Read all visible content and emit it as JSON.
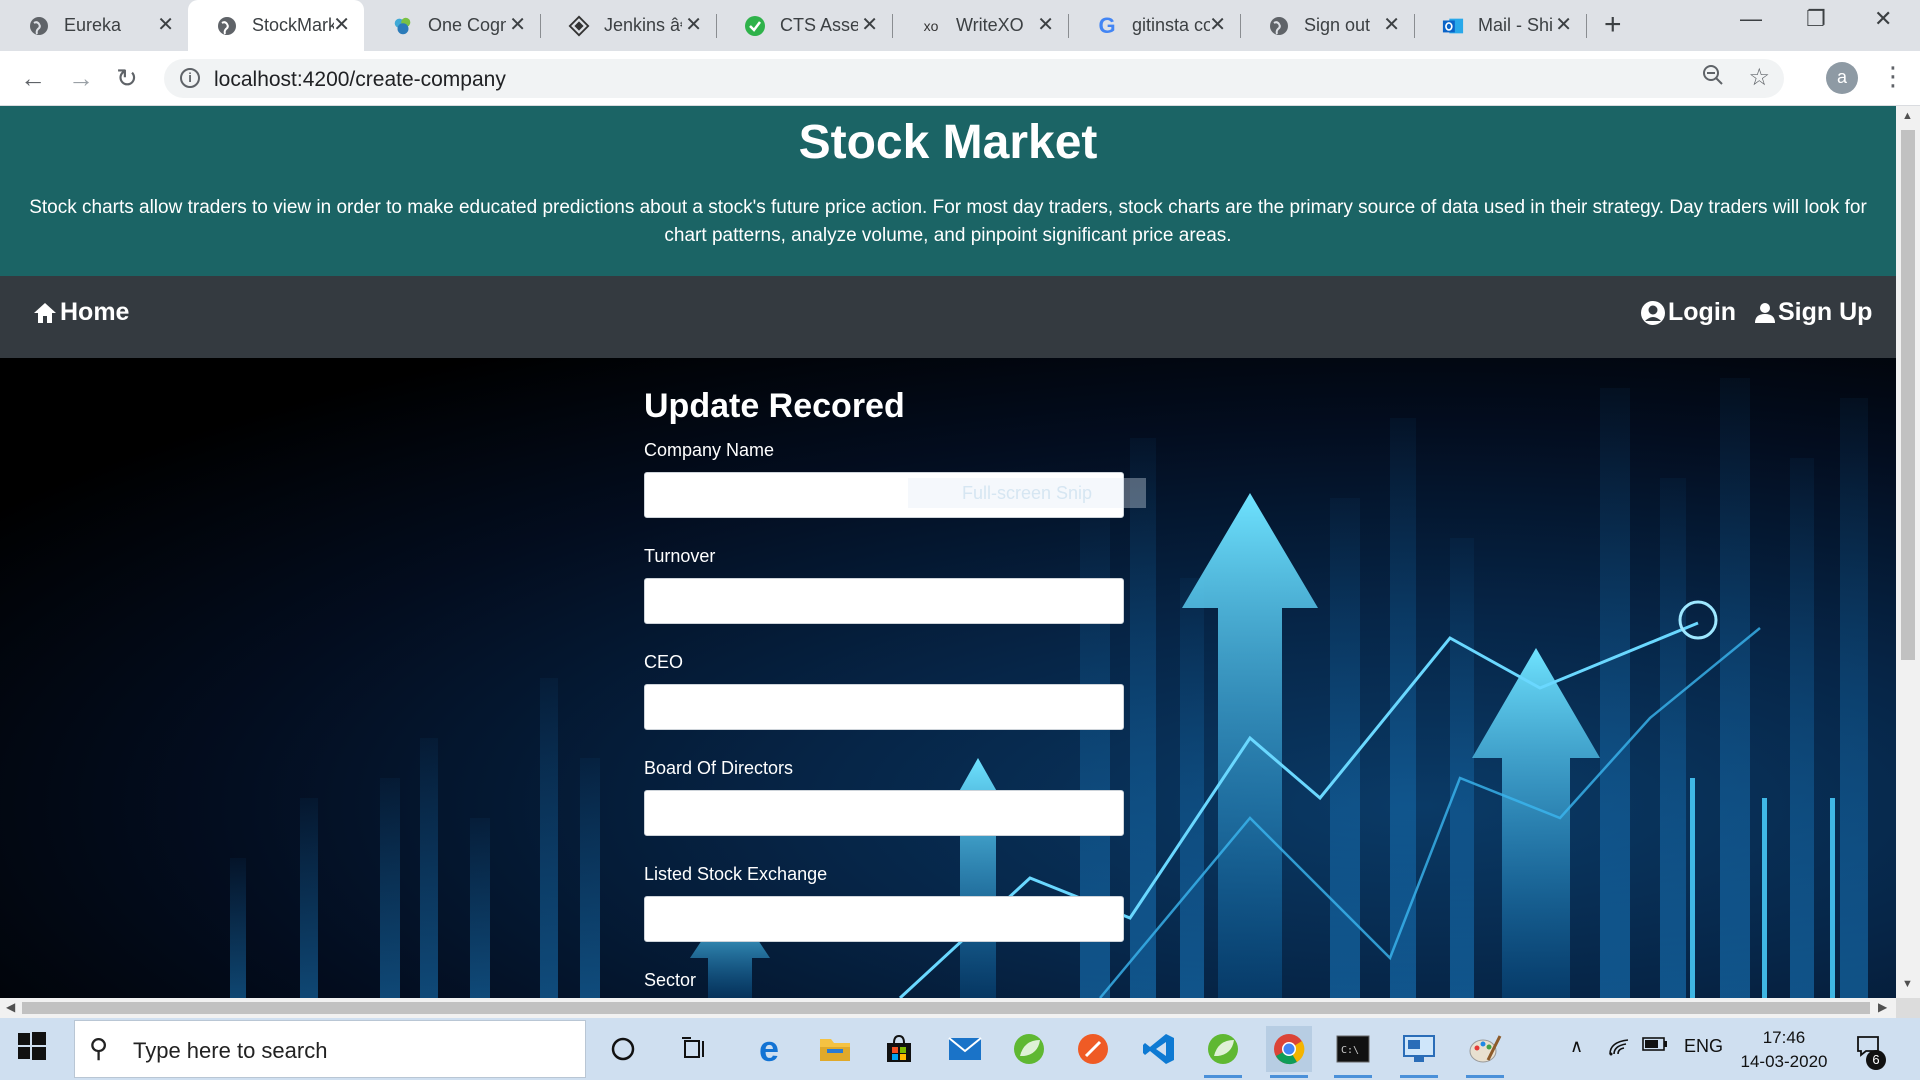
{
  "browser": {
    "tabs": [
      {
        "title": "Eureka",
        "icon": "globe-icon"
      },
      {
        "title": "StockMarket",
        "icon": "globe-icon",
        "active": true
      },
      {
        "title": "One Cognizant",
        "icon": "cognizant-icon"
      },
      {
        "title": "Jenkins â€",
        "icon": "jenkins-icon"
      },
      {
        "title": "CTS Assessment",
        "icon": "check-icon"
      },
      {
        "title": "WriteXO",
        "icon": "writexo-icon"
      },
      {
        "title": "gitinsta co",
        "icon": "google-icon"
      },
      {
        "title": "Sign out",
        "icon": "globe-icon"
      },
      {
        "title": "Mail - Shi",
        "icon": "outlook-icon"
      }
    ],
    "url": "localhost:4200/create-company",
    "avatar_letter": "a"
  },
  "site": {
    "title": "Stock Market",
    "description": "Stock charts allow traders to view in order to make educated predictions about a stock's future price action. For most day traders, stock charts are the primary source of data used in their strategy. Day traders will look for chart patterns, analyze volume, and pinpoint significant price areas.",
    "nav": {
      "home": "Home",
      "login": "Login",
      "signup": "Sign Up"
    }
  },
  "form": {
    "title": "Update Recored",
    "fields": [
      {
        "label": "Company Name",
        "value": ""
      },
      {
        "label": "Turnover",
        "value": ""
      },
      {
        "label": "CEO",
        "value": ""
      },
      {
        "label": "Board Of Directors",
        "value": ""
      },
      {
        "label": "Listed Stock Exchange",
        "value": ""
      },
      {
        "label": "Sector",
        "value": ""
      }
    ],
    "snip_overlay": "Full-screen Snip"
  },
  "taskbar": {
    "search_placeholder": "Type here to search",
    "language": "ENG",
    "time": "17:46",
    "date": "14-03-2020",
    "notification_count": "6"
  }
}
